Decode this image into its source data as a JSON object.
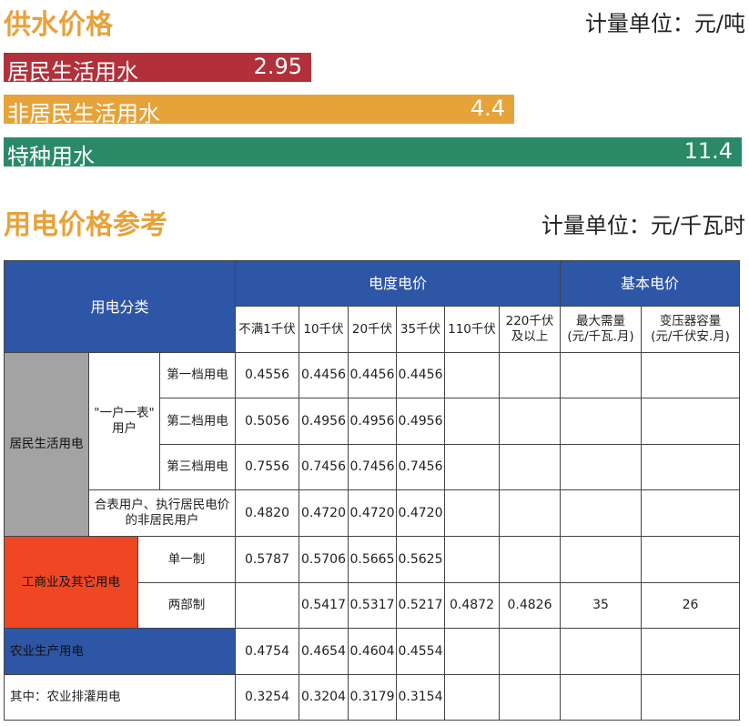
{
  "water": {
    "title": "供水价格",
    "unit": "计量单位：元/吨",
    "items": [
      {
        "label": "居民生活用水",
        "value": "2.95",
        "color": "#b2303a"
      },
      {
        "label": "非居民生活用水",
        "value": "4.4",
        "color": "#e6a33a"
      },
      {
        "label": "特种用水",
        "value": "11.4",
        "color": "#2a8a67"
      }
    ]
  },
  "electric": {
    "title": "用电价格参考",
    "unit": "计量单位：元/千瓦时",
    "headers": {
      "category": "用电分类",
      "energy": "电度电价",
      "basic": "基本电价",
      "volts": [
        "不满1千伏",
        "10千伏",
        "20千伏",
        "35千伏",
        "110千伏",
        "220千伏\n及以上"
      ],
      "basic_cols": [
        "最大需量\n(元/千瓦.月)",
        "变压器容量\n(元/千伏安.月)"
      ]
    },
    "rows": {
      "residential": "居民生活用电",
      "one_meter": "\"一户一表\"\n用户",
      "tier1": "第一档用电",
      "tier2": "第二档用电",
      "tier3": "第三档用电",
      "shared": "合表用户、执行居民电价\n的非居民用户",
      "commercial": "工商业及其它用电",
      "single": "单一制",
      "dual": "两部制",
      "agri": "农业生产用电",
      "irrigation": "其中：农业排灌用电"
    },
    "values": {
      "tier1": [
        "0.4556",
        "0.4456",
        "0.4456",
        "0.4456"
      ],
      "tier2": [
        "0.5056",
        "0.4956",
        "0.4956",
        "0.4956"
      ],
      "tier3": [
        "0.7556",
        "0.7456",
        "0.7456",
        "0.7456"
      ],
      "shared": [
        "0.4820",
        "0.4720",
        "0.4720",
        "0.4720"
      ],
      "single": [
        "0.5787",
        "0.5706",
        "0.5665",
        "0.5625"
      ],
      "dual": [
        "",
        "0.5417",
        "0.5317",
        "0.5217",
        "0.4872",
        "0.4826"
      ],
      "dual_basic": [
        "35",
        "26"
      ],
      "agri": [
        "0.4754",
        "0.4654",
        "0.4604",
        "0.4554"
      ],
      "irrigation": [
        "0.3254",
        "0.3204",
        "0.3179",
        "0.3154"
      ]
    }
  }
}
